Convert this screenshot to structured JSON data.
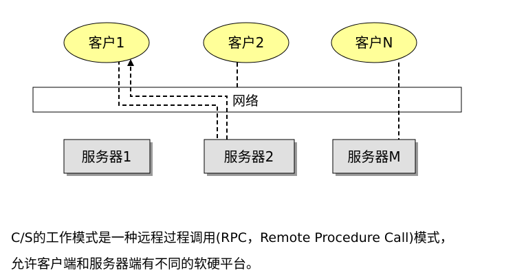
{
  "diagram": {
    "clients": [
      {
        "label": "客户1"
      },
      {
        "label": "客户2"
      },
      {
        "label": "客户N"
      }
    ],
    "network": {
      "label": "网络"
    },
    "servers": [
      {
        "label": "服务器1"
      },
      {
        "label": "服务器2"
      },
      {
        "label": "服务器M"
      }
    ],
    "colors": {
      "client_fill": "#FFFF99",
      "client_stroke": "#000000",
      "server_fill": "#E0E0E0",
      "server_shadow": "#9A9A9A",
      "network_fill": "#FFFFFF",
      "line": "#000000"
    }
  },
  "caption": {
    "line1": "C/S的工作模式是一种远程过程调用(RPC，Remote Procedure Call)模式，",
    "line2": "允许客户端和服务器端有不同的软硬平台。"
  }
}
